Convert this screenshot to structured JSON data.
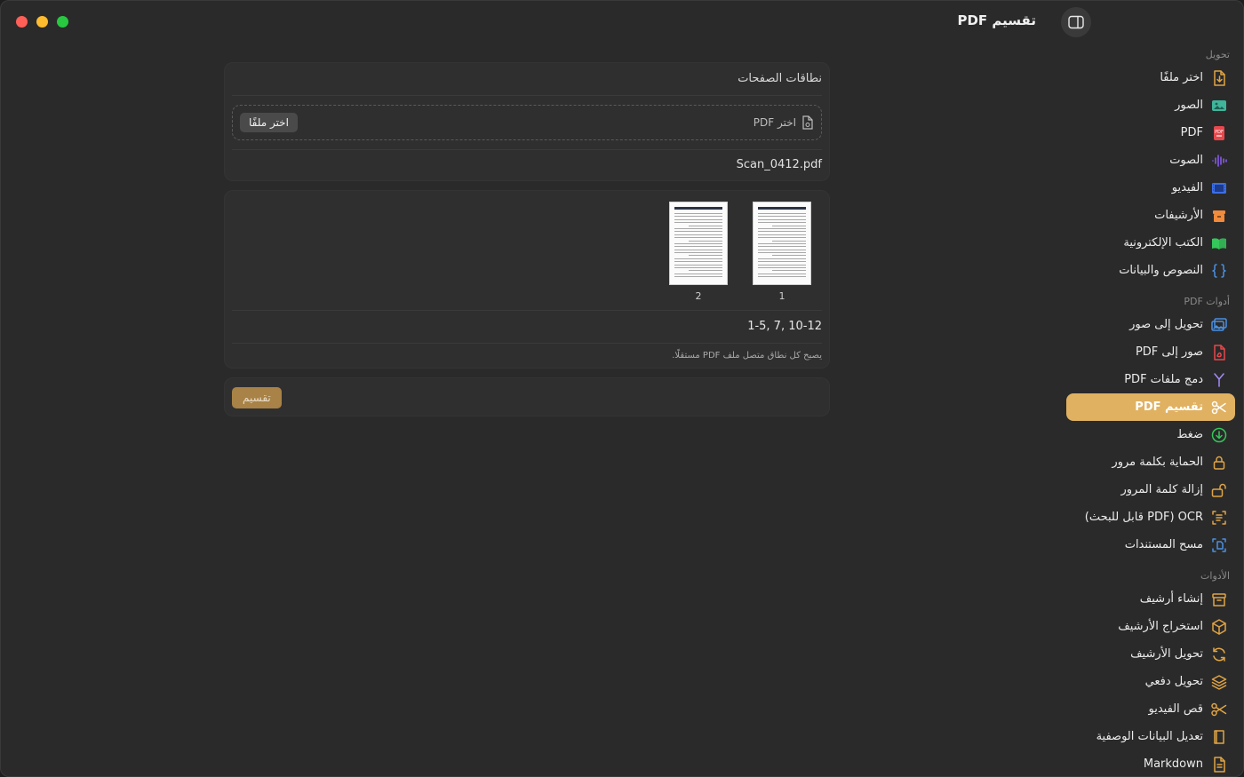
{
  "window": {
    "title": "تقسيم PDF"
  },
  "sidebar": {
    "sections": [
      {
        "title": "تحويل",
        "items": [
          {
            "label": "اختر ملفًا",
            "icon": "file-import-icon",
            "color": "#e0a445"
          },
          {
            "label": "الصور",
            "icon": "image-icon",
            "color": "#3fb59a"
          },
          {
            "label": "PDF",
            "icon": "pdf-icon",
            "color": "#e5484d"
          },
          {
            "label": "الصوت",
            "icon": "audio-wave-icon",
            "color": "#8b5cf6"
          },
          {
            "label": "الفيديو",
            "icon": "film-icon",
            "color": "#3b6ee8"
          },
          {
            "label": "الأرشيفات",
            "icon": "archive-box-icon",
            "color": "#f08a3c"
          },
          {
            "label": "الكتب الإلكترونية",
            "icon": "book-icon",
            "color": "#34c759"
          },
          {
            "label": "النصوص والبيانات",
            "icon": "braces-icon",
            "color": "#4a90e2"
          }
        ]
      },
      {
        "title": "أدوات PDF",
        "items": [
          {
            "label": "تحويل إلى صور",
            "icon": "photos-icon",
            "color": "#4a90e2"
          },
          {
            "label": "صور إلى PDF",
            "icon": "file-pdf-icon",
            "color": "#e5484d"
          },
          {
            "label": "دمج ملفات PDF",
            "icon": "merge-icon",
            "color": "#a78bfa"
          },
          {
            "label": "تقسيم PDF",
            "icon": "scissors-icon",
            "color": "#ffffff",
            "active": true
          },
          {
            "label": "ضغط",
            "icon": "compress-icon",
            "color": "#34c759"
          },
          {
            "label": "الحماية بكلمة مرور",
            "icon": "lock-icon",
            "color": "#e0a445"
          },
          {
            "label": "إزالة كلمة المرور",
            "icon": "unlock-icon",
            "color": "#e0a445"
          },
          {
            "label": "OCR (PDF قابل للبحث)",
            "icon": "ocr-scan-icon",
            "color": "#e0a445"
          },
          {
            "label": "مسح المستندات",
            "icon": "document-scan-icon",
            "color": "#4a90e2"
          }
        ]
      },
      {
        "title": "الأدوات",
        "items": [
          {
            "label": "إنشاء أرشيف",
            "icon": "archive-create-icon",
            "color": "#e0a445"
          },
          {
            "label": "استخراج الأرشيف",
            "icon": "package-extract-icon",
            "color": "#e0a445"
          },
          {
            "label": "تحويل الأرشيف",
            "icon": "refresh-icon",
            "color": "#e0a445"
          },
          {
            "label": "تحويل دفعي",
            "icon": "layers-icon",
            "color": "#e0a445"
          },
          {
            "label": "قص الفيديو",
            "icon": "scissors-video-icon",
            "color": "#e0a445"
          },
          {
            "label": "تعديل البيانات الوصفية",
            "icon": "metadata-book-icon",
            "color": "#e0a445"
          },
          {
            "label": "Markdown",
            "icon": "markdown-doc-icon",
            "color": "#e0a445"
          }
        ]
      }
    ]
  },
  "main": {
    "ranges_card": {
      "header": "نطاقات الصفحات",
      "drop_label": "اختر PDF",
      "choose_button": "اختر ملفًا",
      "filename": "Scan_0412.pdf"
    },
    "pages": [
      {
        "number": "1"
      },
      {
        "number": "2"
      }
    ],
    "ranges_value": "1-5, 7, 10-12",
    "hint": "يصبح كل نطاق متصل ملف PDF مستقلًا.",
    "split_button": "تقسيم"
  },
  "colors": {
    "accent": "#e0b161",
    "split_button_bg": "#a88246"
  }
}
